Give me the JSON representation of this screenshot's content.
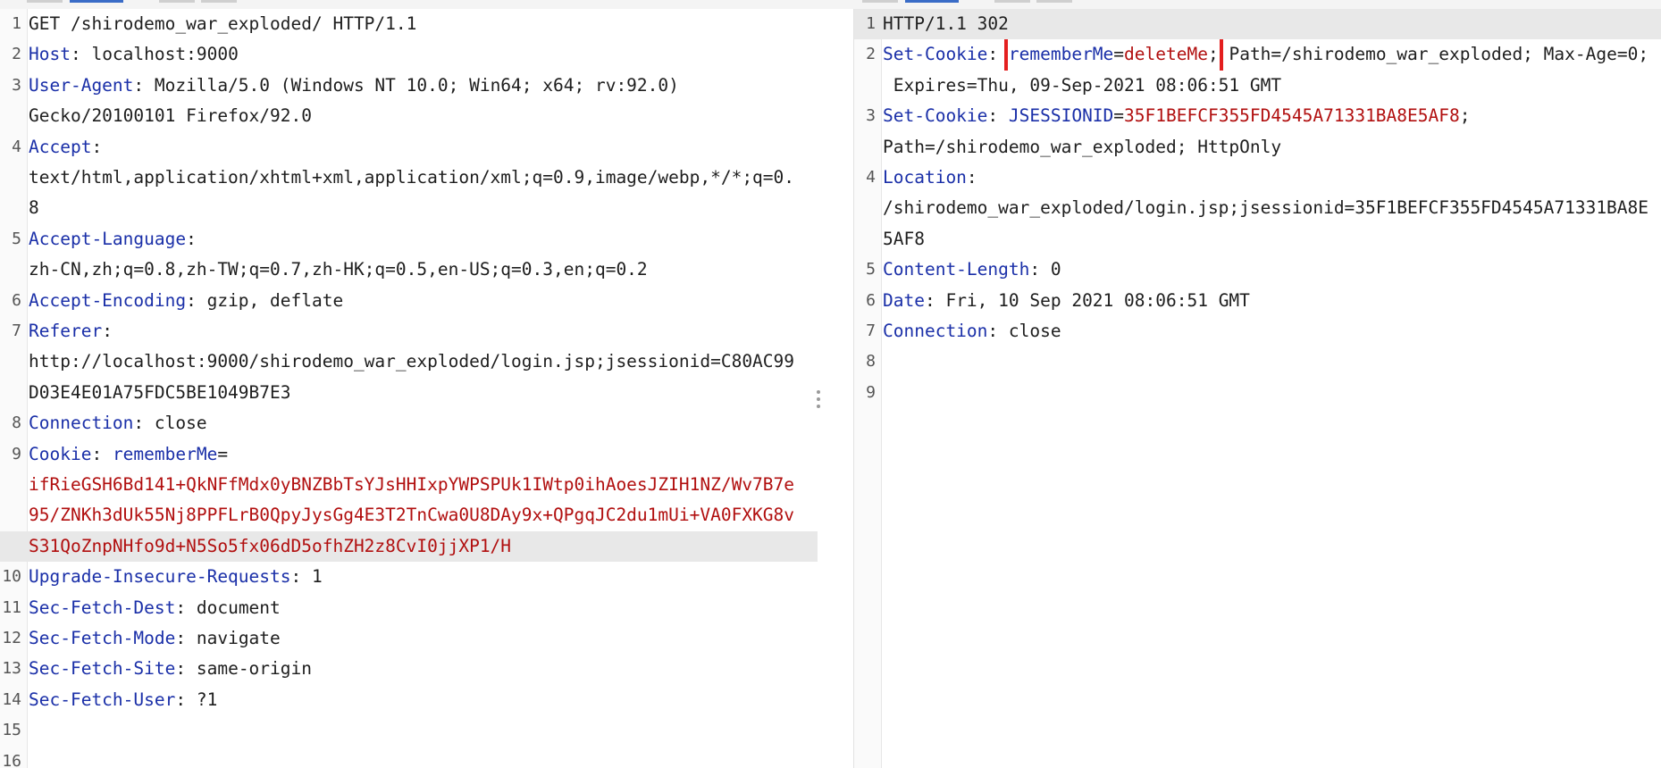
{
  "request": {
    "lines": [
      {
        "n": "1",
        "parts": [
          {
            "t": "GET /shirodemo_war_exploded/ HTTP/1.1",
            "c": "plain"
          }
        ]
      },
      {
        "n": "2",
        "parts": [
          {
            "t": "Host",
            "c": "hn"
          },
          {
            "t": ": localhost:9000",
            "c": "plain"
          }
        ]
      },
      {
        "n": "3",
        "parts": [
          {
            "t": "User-Agent",
            "c": "hn"
          },
          {
            "t": ": Mozilla/5.0 (Windows NT 10.0; Win64; x64; rv:92.0)",
            "c": "plain"
          }
        ]
      },
      {
        "n": "",
        "parts": [
          {
            "t": "Gecko/20100101 Firefox/92.0",
            "c": "plain"
          }
        ]
      },
      {
        "n": "4",
        "parts": [
          {
            "t": "Accept",
            "c": "hn"
          },
          {
            "t": ":",
            "c": "plain"
          }
        ]
      },
      {
        "n": "",
        "parts": [
          {
            "t": "text/html,application/xhtml+xml,application/xml;q=0.9,image/webp,*/*;q=0.",
            "c": "plain"
          }
        ]
      },
      {
        "n": "",
        "parts": [
          {
            "t": "8",
            "c": "plain"
          }
        ]
      },
      {
        "n": "5",
        "parts": [
          {
            "t": "Accept-Language",
            "c": "hn"
          },
          {
            "t": ":",
            "c": "plain"
          }
        ]
      },
      {
        "n": "",
        "parts": [
          {
            "t": "zh-CN,zh;q=0.8,zh-TW;q=0.7,zh-HK;q=0.5,en-US;q=0.3,en;q=0.2",
            "c": "plain"
          }
        ]
      },
      {
        "n": "6",
        "parts": [
          {
            "t": "Accept-Encoding",
            "c": "hn"
          },
          {
            "t": ": gzip, deflate",
            "c": "plain"
          }
        ]
      },
      {
        "n": "7",
        "parts": [
          {
            "t": "Referer",
            "c": "hn"
          },
          {
            "t": ":",
            "c": "plain"
          }
        ]
      },
      {
        "n": "",
        "parts": [
          {
            "t": "http://localhost:9000/shirodemo_war_exploded/login.jsp;jsessionid=C80AC99",
            "c": "plain"
          }
        ]
      },
      {
        "n": "",
        "parts": [
          {
            "t": "D03E4E01A75FDC5BE1049B7E3",
            "c": "plain"
          }
        ]
      },
      {
        "n": "8",
        "parts": [
          {
            "t": "Connection",
            "c": "hn"
          },
          {
            "t": ": close",
            "c": "plain"
          }
        ]
      },
      {
        "n": "9",
        "parts": [
          {
            "t": "Cookie",
            "c": "hn"
          },
          {
            "t": ": ",
            "c": "plain"
          },
          {
            "t": "rememberMe",
            "c": "ck"
          },
          {
            "t": "=",
            "c": "plain"
          }
        ]
      },
      {
        "n": "",
        "parts": [
          {
            "t": "ifRieGSH6Bd141+QkNFfMdx0yBNZBbTsYJsHHIxpYWPSPUk1IWtp0ihAoesJZIH1NZ/Wv7B7e",
            "c": "cv"
          }
        ]
      },
      {
        "n": "",
        "parts": [
          {
            "t": "95/ZNKh3dUk55Nj8PPFLrB0QpyJysGg4E3T2TnCwa0U8DAy9x+QPgqJC2du1mUi+VA0FXKG8v",
            "c": "cv"
          }
        ]
      },
      {
        "n": "",
        "hl": true,
        "parts": [
          {
            "t": "S31QoZnpNHfo9d+N5So5fx06dD5ofhZH2z8CvI0jjXP1/H",
            "c": "cv"
          }
        ]
      },
      {
        "n": "10",
        "parts": [
          {
            "t": "Upgrade-Insecure-Requests",
            "c": "hn"
          },
          {
            "t": ": 1",
            "c": "plain"
          }
        ]
      },
      {
        "n": "11",
        "parts": [
          {
            "t": "Sec-Fetch-Dest",
            "c": "hn"
          },
          {
            "t": ": document",
            "c": "plain"
          }
        ]
      },
      {
        "n": "12",
        "parts": [
          {
            "t": "Sec-Fetch-Mode",
            "c": "hn"
          },
          {
            "t": ": navigate",
            "c": "plain"
          }
        ]
      },
      {
        "n": "13",
        "parts": [
          {
            "t": "Sec-Fetch-Site",
            "c": "hn"
          },
          {
            "t": ": same-origin",
            "c": "plain"
          }
        ]
      },
      {
        "n": "14",
        "parts": [
          {
            "t": "Sec-Fetch-User",
            "c": "hn"
          },
          {
            "t": ": ?1",
            "c": "plain"
          }
        ]
      },
      {
        "n": "15",
        "parts": []
      },
      {
        "n": "16",
        "parts": []
      }
    ]
  },
  "response": {
    "lines": [
      {
        "n": "1",
        "hl": true,
        "parts": [
          {
            "t": "HTTP/1.1 302",
            "c": "plain"
          }
        ]
      },
      {
        "n": "2",
        "parts": [
          {
            "t": "Set-Cookie",
            "c": "hn"
          },
          {
            "t": ": ",
            "c": "plain"
          },
          {
            "t": "rememberMe",
            "c": "ck",
            "box": "start"
          },
          {
            "t": "=",
            "c": "plain"
          },
          {
            "t": "deleteMe",
            "c": "cv"
          },
          {
            "t": ";",
            "c": "plain",
            "box": "end"
          },
          {
            "t": " Path=/shirodemo_war_exploded; Max-Age=0;",
            "c": "plain"
          }
        ]
      },
      {
        "n": "",
        "parts": [
          {
            "t": " Expires=Thu, 09-Sep-2021 08:06:51 GMT",
            "c": "plain"
          }
        ]
      },
      {
        "n": "3",
        "parts": [
          {
            "t": "Set-Cookie",
            "c": "hn"
          },
          {
            "t": ": ",
            "c": "plain"
          },
          {
            "t": "JSESSIONID",
            "c": "ck"
          },
          {
            "t": "=",
            "c": "plain"
          },
          {
            "t": "35F1BEFCF355FD4545A71331BA8E5AF8",
            "c": "cv"
          },
          {
            "t": ";",
            "c": "plain"
          }
        ]
      },
      {
        "n": "",
        "parts": [
          {
            "t": "Path=/shirodemo_war_exploded; HttpOnly",
            "c": "plain"
          }
        ]
      },
      {
        "n": "4",
        "parts": [
          {
            "t": "Location",
            "c": "hn"
          },
          {
            "t": ":",
            "c": "plain"
          }
        ]
      },
      {
        "n": "",
        "parts": [
          {
            "t": "/shirodemo_war_exploded/login.jsp;jsessionid=35F1BEFCF355FD4545A71331BA8E",
            "c": "plain"
          }
        ]
      },
      {
        "n": "",
        "parts": [
          {
            "t": "5AF8",
            "c": "plain"
          }
        ]
      },
      {
        "n": "5",
        "parts": [
          {
            "t": "Content-Length",
            "c": "hn"
          },
          {
            "t": ": 0",
            "c": "plain"
          }
        ]
      },
      {
        "n": "6",
        "parts": [
          {
            "t": "Date",
            "c": "hn"
          },
          {
            "t": ": Fri, 10 Sep 2021 08:06:51 GMT",
            "c": "plain"
          }
        ]
      },
      {
        "n": "7",
        "parts": [
          {
            "t": "Connection",
            "c": "hn"
          },
          {
            "t": ": close",
            "c": "plain"
          }
        ]
      },
      {
        "n": "8",
        "parts": []
      },
      {
        "n": "9",
        "parts": []
      }
    ]
  },
  "colors": {
    "header_name": "#1a2fa8",
    "cookie_value": "#b10f0f",
    "highlight_box": "#e41f1f",
    "selected_line": "#e8e8e8"
  },
  "icons": {
    "divider_handle": "vertical-dots-icon"
  }
}
